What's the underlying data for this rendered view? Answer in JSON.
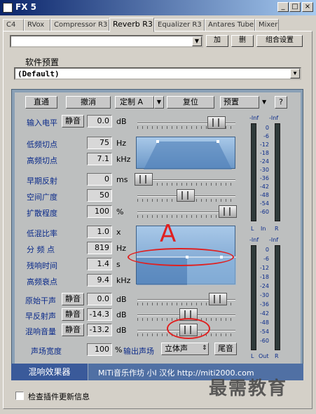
{
  "window": {
    "title": "FX 5",
    "min": "_",
    "max": "□",
    "close": "×"
  },
  "tabs": [
    "C4",
    "RVox",
    "Compressor R3",
    "Reverb R3",
    "Equalizer R3",
    "Antares Tube",
    "Mixer"
  ],
  "top": {
    "add": "加",
    "remove": "删",
    "config": "组合设置"
  },
  "preset_section": {
    "label": "软件预置",
    "value": "(Default)"
  },
  "toolbar": {
    "bypass": "直通",
    "undo": "撤消",
    "custom": "定制 A",
    "reset": "复位",
    "preset": "预置",
    "help": "?"
  },
  "controls": {
    "input": {
      "label": "输入电平",
      "mute": "静音",
      "value": "0.0",
      "unit": "dB"
    },
    "low_cut": {
      "label": "低频切点",
      "value": "75",
      "unit": "Hz"
    },
    "high_cut": {
      "label": "高频切点",
      "value": "7.1",
      "unit": "kHz"
    },
    "early": {
      "label": "早期反射",
      "value": "0",
      "unit": "ms"
    },
    "space": {
      "label": "空间广度",
      "value": "50"
    },
    "diffusion": {
      "label": "扩散程度",
      "value": "100",
      "unit": "%"
    },
    "low_ratio": {
      "label": "低混比率",
      "value": "1.0",
      "unit": "x"
    },
    "crossover": {
      "label": "分 频 点",
      "value": "819",
      "unit": "Hz"
    },
    "decay": {
      "label": "残响时间",
      "value": "1.4",
      "unit": "s"
    },
    "damping": {
      "label": "高频衰点",
      "value": "9.4",
      "unit": "kHz"
    },
    "dry": {
      "label": "原始干声",
      "mute": "静音",
      "value": "0.0",
      "unit": "dB"
    },
    "er": {
      "label": "早反射声",
      "mute": "静音",
      "value": "-14.3",
      "unit": "dB"
    },
    "reverb": {
      "label": "混响音量",
      "mute": "静音",
      "value": "-13.2",
      "unit": "dB"
    },
    "width": {
      "label": "声场宽度",
      "value": "100",
      "unit": "%"
    },
    "output": {
      "label": "输出声场",
      "value": "立体声",
      "tail": "尾音"
    }
  },
  "meters": {
    "top": {
      "left": "-Inf",
      "right": "-Inf",
      "ticks": [
        "0",
        "-6",
        "-12",
        "-18",
        "-24",
        "-30",
        "-36",
        "-42",
        "-48",
        "-54",
        "-60"
      ],
      "l": "L",
      "in": "In",
      "r": "R"
    },
    "bottom": {
      "left": "-Inf",
      "right": "-Inf",
      "ticks": [
        "0",
        "-6",
        "-12",
        "-18",
        "-24",
        "-30",
        "-36",
        "-42",
        "-48",
        "-54",
        "-60"
      ],
      "l": "L",
      "out": "Out",
      "r": "R"
    }
  },
  "annotation": {
    "letter": "A"
  },
  "bottom": {
    "name": "混响效果器",
    "credit": "MiTi音乐作坊 小I 汉化 http://miti2000.com"
  },
  "watermark": "最需教育",
  "checkbox": {
    "label": "检查插件更新信息"
  }
}
